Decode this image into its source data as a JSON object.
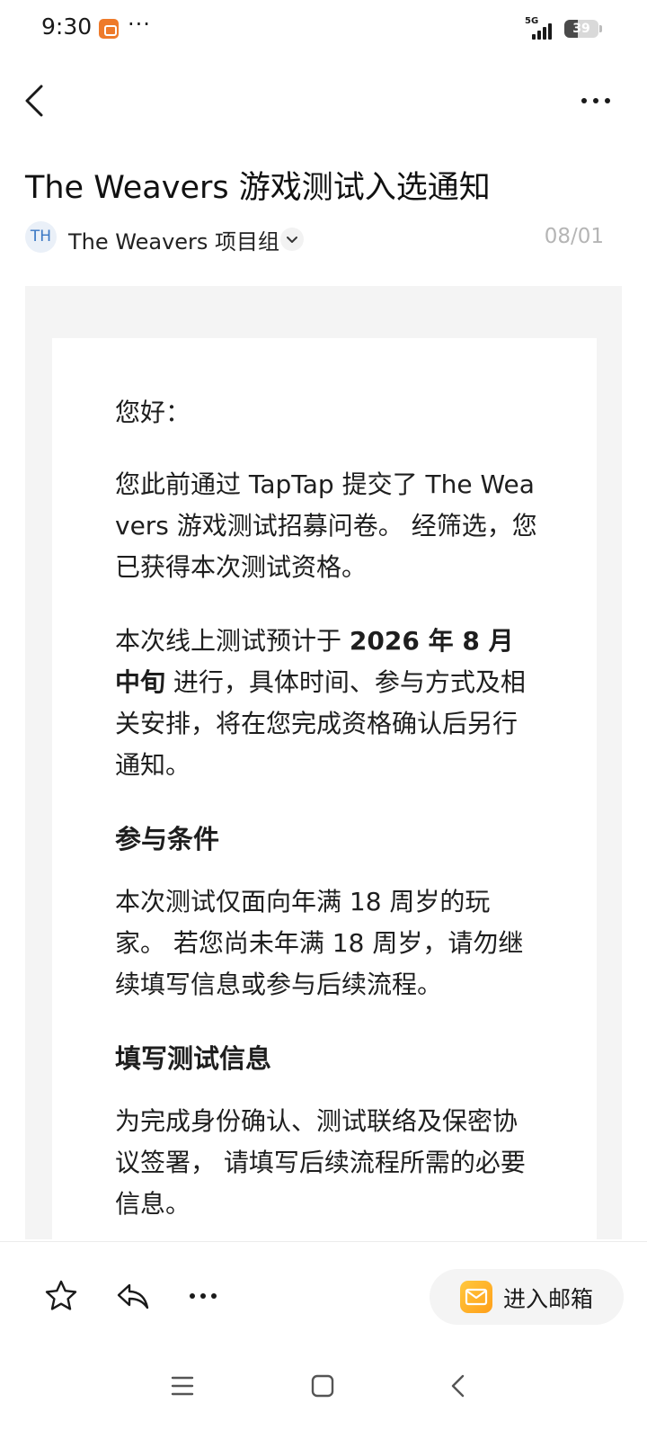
{
  "status_bar": {
    "time": "9:30",
    "more": "···",
    "network": "5G",
    "battery": "39",
    "battery_level": 0.39
  },
  "email": {
    "subject": "The Weavers 游戏测试入选通知",
    "sender_initials": "TH",
    "sender_name": "The Weavers 项目组",
    "date": "08/01",
    "greeting": "您好：",
    "para1": "您此前通过 TapTap 提交了 The Weavers 游戏测试招募问卷。 经筛选，您已获得本次测试资格。",
    "para2_prefix": "本次线上测试预计于 ",
    "para2_bold": "2026 年 8 月中旬",
    "para2_suffix": " 进行，具体时间、参与方式及相关安排，将在您完成资格确认后另行通知。",
    "section1_heading": "参与条件",
    "section1_text": "本次测试仅面向年满 18 周岁的玩家。 若您尚未年满 18 周岁，请勿继续填写信息或参与后续流程。",
    "section2_heading": "填写测试信息",
    "section2_text": "为完成身份确认、测试联络及保密协议签署， 请填写后续流程所需的必要信息。"
  },
  "action_bar": {
    "enter_mailbox": "进入邮箱"
  },
  "icons": {
    "back": "chevron-left-icon",
    "more": "more-horizontal-icon",
    "star": "star-outline-icon",
    "reply": "reply-icon",
    "mailbox": "mail-icon",
    "nav_menu": "menu-icon",
    "nav_home": "square-icon",
    "nav_back": "chevron-left-icon"
  },
  "colors": {
    "avatar_text": "#3b78c4",
    "mailbox_icon": "#ffb52e",
    "frame_bg": "#f4f4f4"
  }
}
